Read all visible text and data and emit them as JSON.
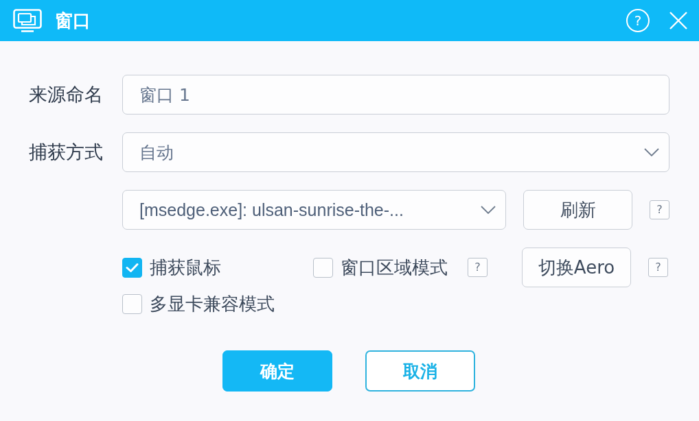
{
  "window": {
    "title": "窗口",
    "help": "?"
  },
  "form": {
    "source_name": {
      "label": "来源命名",
      "value": "窗口 1"
    },
    "capture_method": {
      "label": "捕获方式",
      "value": "自动"
    },
    "window_source": {
      "value": "[msedge.exe]: ulsan-sunrise-the-...",
      "button": "刷新",
      "help": "?"
    }
  },
  "options": [
    {
      "kind": "checkbox",
      "label": "捕获鼠标",
      "checked": true
    },
    {
      "kind": "checkbox",
      "label": "窗口区域模式",
      "checked": false,
      "help": "?"
    },
    {
      "kind": "button",
      "label": "切换Aero",
      "help": "?"
    },
    {
      "kind": "checkbox",
      "label": "多显卡兼容模式",
      "checked": false
    }
  ],
  "buttons": [
    {
      "kind": "primary",
      "label": "确定"
    },
    {
      "kind": "secondary",
      "label": "取消"
    }
  ]
}
